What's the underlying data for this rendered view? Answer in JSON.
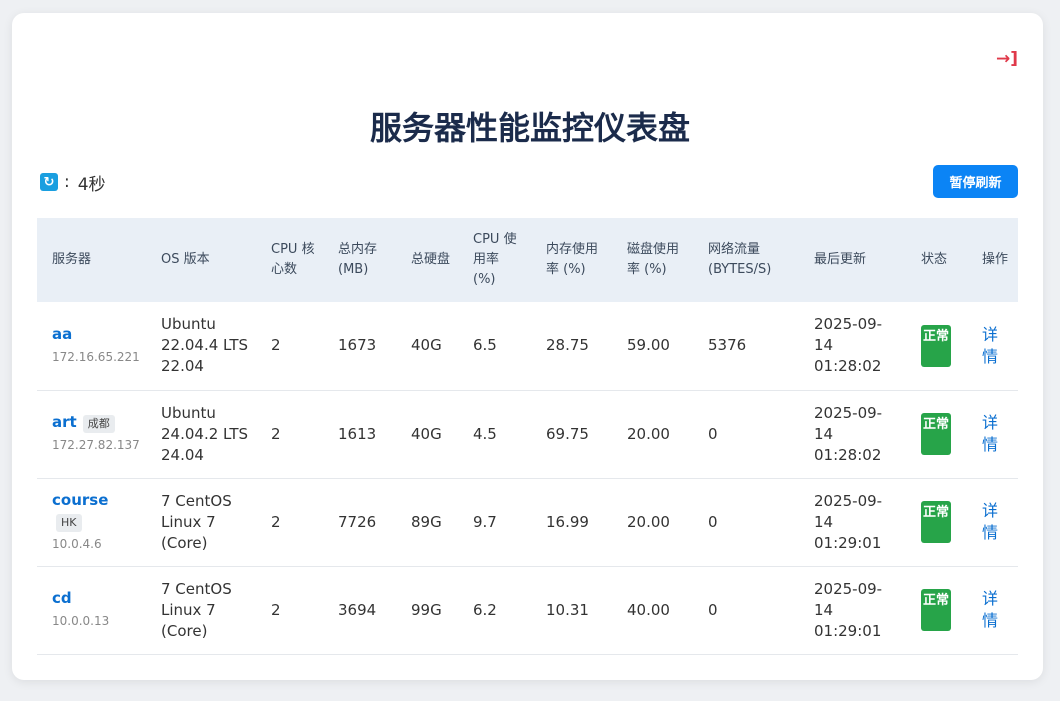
{
  "header": {
    "logout_icon": "→]",
    "title": "服务器性能监控仪表盘",
    "refresh_icon": "🔄",
    "refresh_sep": ":",
    "refresh_interval": "4秒",
    "pause_label": "暂停刷新"
  },
  "table": {
    "columns": {
      "server": "服务器",
      "os": "OS 版本",
      "cpu_cores": "CPU 核心数",
      "mem_total": "总内存 (MB)",
      "disk_total": "总硬盘",
      "cpu_usage": "CPU 使用率 (%)",
      "mem_usage": "内存使用率 (%)",
      "disk_usage": "磁盘使用率 (%)",
      "net": "网络流量 (BYTES/S)",
      "updated": "最后更新",
      "status": "状态",
      "action": "操作"
    },
    "rows": [
      {
        "name": "aa",
        "tag": "",
        "ip": "172.16.65.221",
        "os": "Ubuntu 22.04.4 LTS 22.04",
        "cores": "2",
        "mem": "1673",
        "disk": "40G",
        "cpu": "6.5",
        "mem_pct": "28.75",
        "disk_pct": "59.00",
        "net": "5376",
        "updated": "2025-09-14 01:28:02",
        "status": "正常",
        "action": "详情"
      },
      {
        "name": "art",
        "tag": "成都",
        "ip": "172.27.82.137",
        "os": "Ubuntu 24.04.2 LTS 24.04",
        "cores": "2",
        "mem": "1613",
        "disk": "40G",
        "cpu": "4.5",
        "mem_pct": "69.75",
        "disk_pct": "20.00",
        "net": "0",
        "updated": "2025-09-14 01:28:02",
        "status": "正常",
        "action": "详情"
      },
      {
        "name": "course",
        "tag": "HK",
        "ip": "10.0.4.6",
        "os": "7 CentOS Linux 7 (Core)",
        "cores": "2",
        "mem": "7726",
        "disk": "89G",
        "cpu": "9.7",
        "mem_pct": "16.99",
        "disk_pct": "20.00",
        "net": "0",
        "updated": "2025-09-14 01:29:01",
        "status": "正常",
        "action": "详情"
      },
      {
        "name": "cd",
        "tag": "",
        "ip": "10.0.0.13",
        "os": "7 CentOS Linux 7 (Core)",
        "cores": "2",
        "mem": "3694",
        "disk": "99G",
        "cpu": "6.2",
        "mem_pct": "10.31",
        "disk_pct": "40.00",
        "net": "0",
        "updated": "2025-09-14 01:29:01",
        "status": "正常",
        "action": "详情"
      }
    ]
  },
  "colors": {
    "accent": "#0b84f5",
    "link": "#0b6fd0",
    "status_ok": "#27a449",
    "logout": "#e0394a",
    "title": "#1b2b4b"
  }
}
